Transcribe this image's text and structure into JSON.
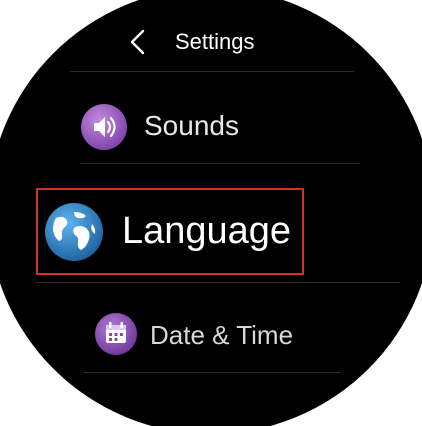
{
  "header": {
    "title": "Settings",
    "back_icon": "chevron-left-icon"
  },
  "items": [
    {
      "label": "Sounds",
      "icon": "speaker-icon",
      "icon_color": "#9b59b6"
    },
    {
      "label": "Language",
      "icon": "globe-icon",
      "icon_color": "#2f86c8",
      "highlighted": true
    },
    {
      "label": "Date & Time",
      "icon": "calendar-icon",
      "icon_color": "#8e44ad"
    }
  ],
  "colors": {
    "background": "#000000",
    "highlight_border": "#d6302e",
    "text": "#ffffff"
  }
}
